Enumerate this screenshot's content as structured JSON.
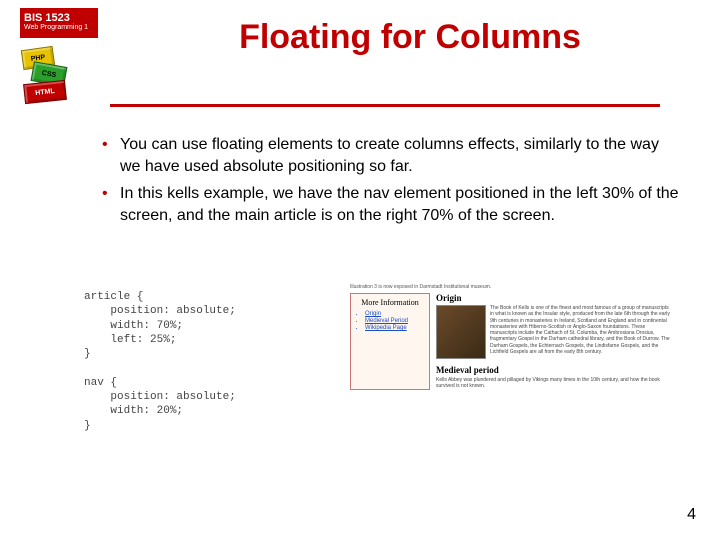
{
  "header": {
    "course_code": "BIS 1523",
    "course_name": "Web Programming 1",
    "blocks": [
      "PHP",
      "CSS",
      "HTML"
    ]
  },
  "title": "Floating for Columns",
  "bullets": [
    "You can use floating elements to create columns effects, similarly to the way we have used absolute positioning so far.",
    "In this kells example, we have the nav element positioned in the left 30% of the screen, and the main article is on the right 70% of the screen."
  ],
  "code": "article {\n    position: absolute;\n    width: 70%;\n    left: 25%;\n}\n\nnav {\n    position: absolute;\n    width: 20%;\n}",
  "preview": {
    "intro_text": "Illustration 3 is now exposed in Darmstadt Institutional museum.",
    "nav_title": "More Information",
    "nav_links": [
      "Origin",
      "Medieval Period",
      "Wikipedia Page"
    ],
    "h1": "Origin",
    "p1": "The Book of Kells is one of the finest and most famous of a group of manuscripts in what is known as the Insular style, produced from the late 6th through the early 9th centuries in monasteries in Ireland, Scotland and England and in continental monasteries with Hiberno-Scottish or Anglo-Saxon foundations. These manuscripts include the Cathach of St. Columba, the Ambrosiana Orosius, fragmentary Gospel in the Durham cathedral library, and the Book of Durrow. The Durham Gospels, the Echternach Gospels, the Lindisfarne Gospels, and the Lichfield Gospels are all from the early 8th century.",
    "h2": "Medieval period",
    "p2": "Kells Abbey was plundered and pillaged by Vikings many times in the 10th century, and how the book survived is not known."
  },
  "page_number": "4"
}
